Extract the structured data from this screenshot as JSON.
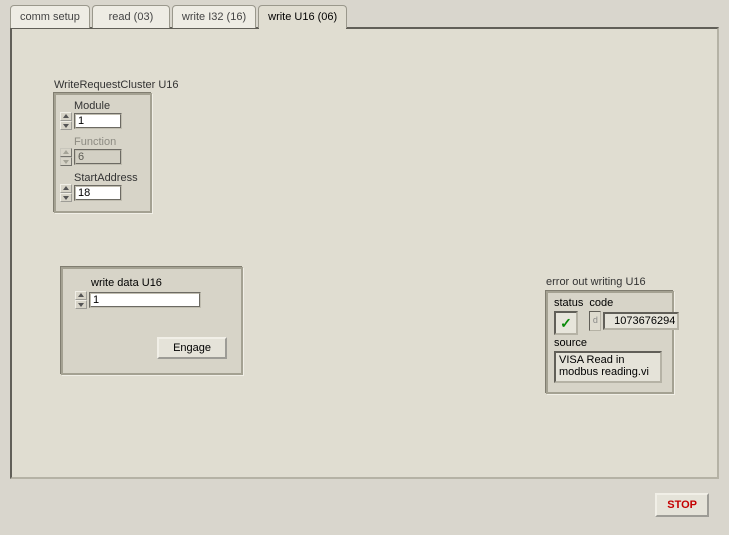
{
  "tabs": [
    {
      "label": "comm setup"
    },
    {
      "label": "read (03)"
    },
    {
      "label": "write I32 (16)"
    },
    {
      "label": "write U16 (06)"
    }
  ],
  "active_tab": 3,
  "cluster": {
    "title": "WriteRequestCluster U16",
    "module": {
      "label": "Module",
      "value": "1"
    },
    "function": {
      "label": "Function",
      "value": "6"
    },
    "start_address": {
      "label": "StartAddress",
      "value": "18"
    }
  },
  "write_data": {
    "title": "write data U16",
    "value": "1",
    "engage_label": "Engage"
  },
  "error_out": {
    "title": "error out writing U16",
    "status_label": "status",
    "status_ok": true,
    "code_label": "code",
    "code_value": "1073676294",
    "source_label": "source",
    "source_value": "VISA Read in modbus reading.vi"
  },
  "stop_label": "STOP"
}
